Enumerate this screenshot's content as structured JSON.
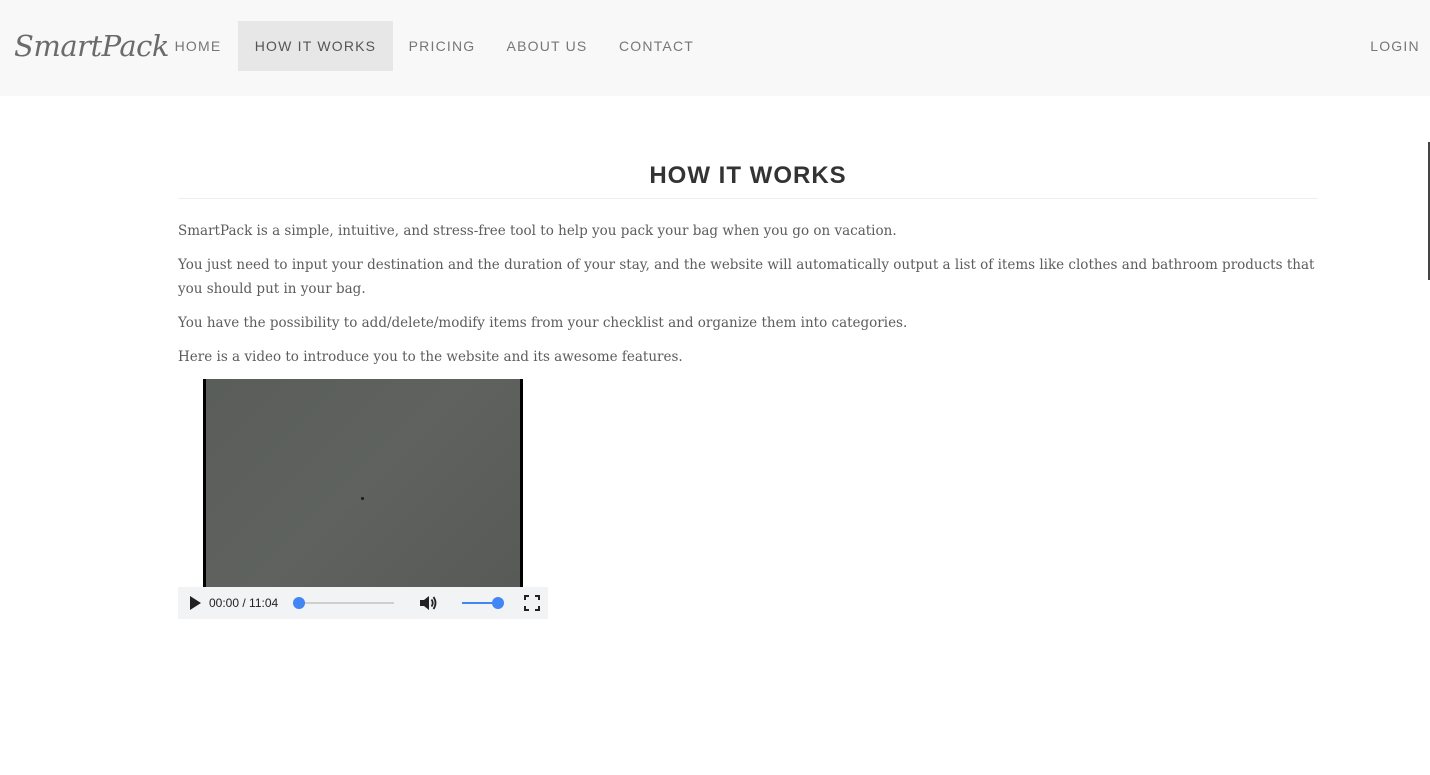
{
  "navbar": {
    "brand": "SmartPack",
    "items": [
      {
        "label": "HOME"
      },
      {
        "label": "HOW IT WORKS",
        "active": true
      },
      {
        "label": "PRICING"
      },
      {
        "label": "ABOUT US"
      },
      {
        "label": "CONTACT"
      }
    ],
    "login": "LOGIN"
  },
  "main": {
    "title": "HOW IT WORKS",
    "paragraphs": [
      "SmartPack is a simple, intuitive, and stress-free tool to help you pack your bag when you go on vacation.",
      "You just need to input your destination and the duration of your stay, and the website will automatically output a list of items like clothes and bathroom products that you should put in your bag.",
      "You have the possibility to add/delete/modify items from your checklist and organize them into categories.",
      "Here is a video to introduce you to the website and its awesome features."
    ]
  },
  "video": {
    "time_display": "00:00 / 11:04",
    "progress": 0,
    "volume": 1.0,
    "icons": {
      "play": "play-icon",
      "volume": "volume-icon",
      "fullscreen": "fullscreen-icon"
    },
    "accent_color": "#4285f4"
  },
  "colors": {
    "navbar_bg": "#f8f8f8",
    "active_tab_bg": "#e7e7e7",
    "text": "#5c5c5c",
    "heading": "#333333"
  }
}
